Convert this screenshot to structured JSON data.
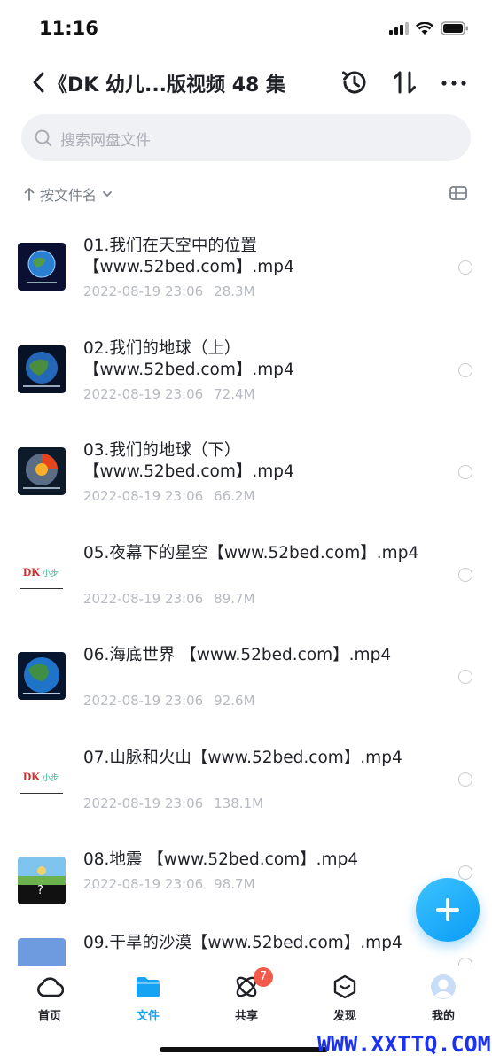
{
  "status_bar": {
    "time": "11:16"
  },
  "header": {
    "title": "《DK 幼儿...版视频 48 集"
  },
  "search": {
    "placeholder": "搜索网盘文件"
  },
  "sort": {
    "label": "按文件名"
  },
  "files": [
    {
      "name": "01.我们在天空中的位置【www.52bed.com】.mp4",
      "date": "2022-08-19 23:06",
      "size": "28.3M"
    },
    {
      "name": "02.我们的地球（上）【www.52bed.com】.mp4",
      "date": "2022-08-19 23:06",
      "size": "72.4M"
    },
    {
      "name": "03.我们的地球（下）【www.52bed.com】.mp4",
      "date": "2022-08-19 23:06",
      "size": "66.2M"
    },
    {
      "name": "05.夜幕下的星空【www.52bed.com】.mp4",
      "date": "2022-08-19 23:06",
      "size": "89.7M"
    },
    {
      "name": "06.海底世界 【www.52bed.com】.mp4",
      "date": "2022-08-19 23:06",
      "size": "92.6M"
    },
    {
      "name": "07.山脉和火山【www.52bed.com】.mp4",
      "date": "2022-08-19 23:06",
      "size": "138.1M"
    },
    {
      "name": "08.地震 【www.52bed.com】.mp4",
      "date": "2022-08-19 23:06",
      "size": "98.7M"
    },
    {
      "name": "09.干旱的沙漠【www.52bed.com】.mp4",
      "date": "",
      "size": ""
    }
  ],
  "thumbnails": {
    "dk_logo": "DK",
    "xiaobu": "小步",
    "question_mark": "?"
  },
  "tabs": [
    {
      "label": "首页",
      "icon": "cloud-home-icon"
    },
    {
      "label": "文件",
      "icon": "folder-icon"
    },
    {
      "label": "共享",
      "icon": "share-orbit-icon",
      "badge": "7"
    },
    {
      "label": "发现",
      "icon": "discover-box-icon"
    },
    {
      "label": "我的",
      "icon": "avatar-icon"
    }
  ],
  "watermark": "WWW.XXTTQ.COM",
  "colors": {
    "accent": "#17a3f3",
    "badge": "#f25a4a",
    "watermark": "#1b32f2"
  }
}
